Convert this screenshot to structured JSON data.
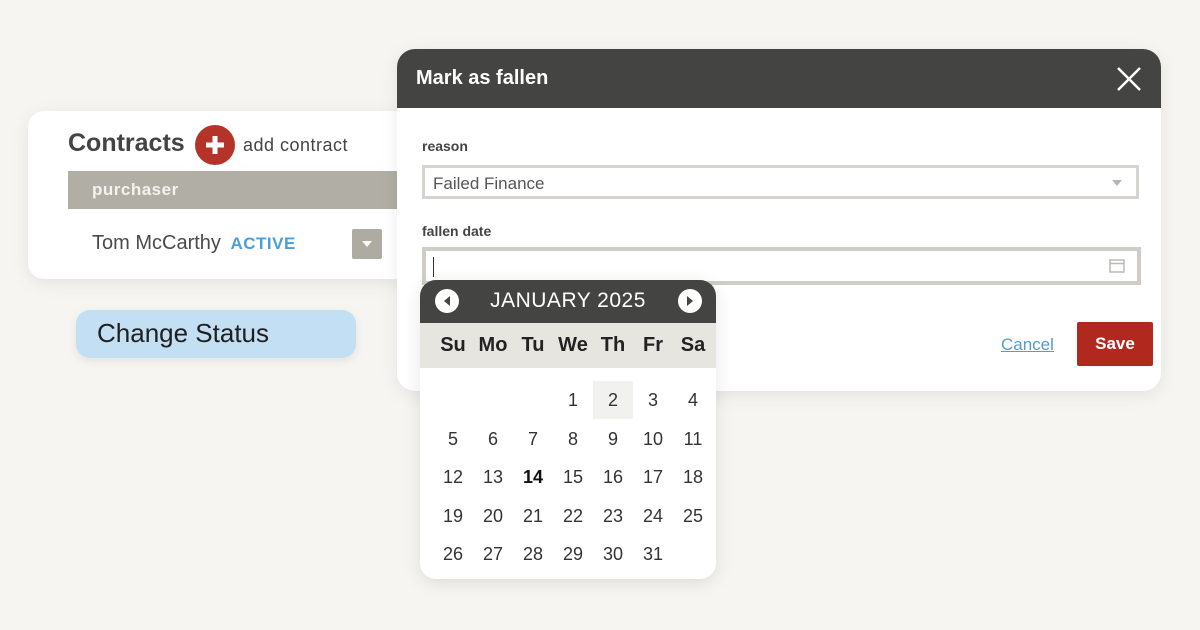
{
  "contracts": {
    "title": "Contracts",
    "add_label": "add contract",
    "column_header": "purchaser",
    "row": {
      "name": "Tom McCarthy",
      "status": "ACTIVE"
    }
  },
  "change_status_label": "Change Status",
  "modal": {
    "title": "Mark as fallen",
    "reason_label": "reason",
    "reason_value": "Failed Finance",
    "date_label": "fallen date",
    "date_value": "",
    "cancel_label": "Cancel",
    "save_label": "Save"
  },
  "datepicker": {
    "month_label": "JANUARY 2025",
    "weekdays": [
      "Su",
      "Mo",
      "Tu",
      "We",
      "Th",
      "Fr",
      "Sa"
    ],
    "first_weekday_index": 3,
    "days_in_month": 31,
    "highlighted_day": 2,
    "today": 14
  },
  "colors": {
    "brand_red": "#b5342a",
    "header_dark": "#444443",
    "link_blue": "#4d9dd6",
    "status_blue_bg": "#c2dff4"
  },
  "icons": {
    "add": "plus-icon",
    "close": "close-icon",
    "prev": "chevron-left-icon",
    "next": "chevron-right-icon",
    "calendar": "calendar-icon",
    "dropdown": "chevron-down-icon"
  }
}
